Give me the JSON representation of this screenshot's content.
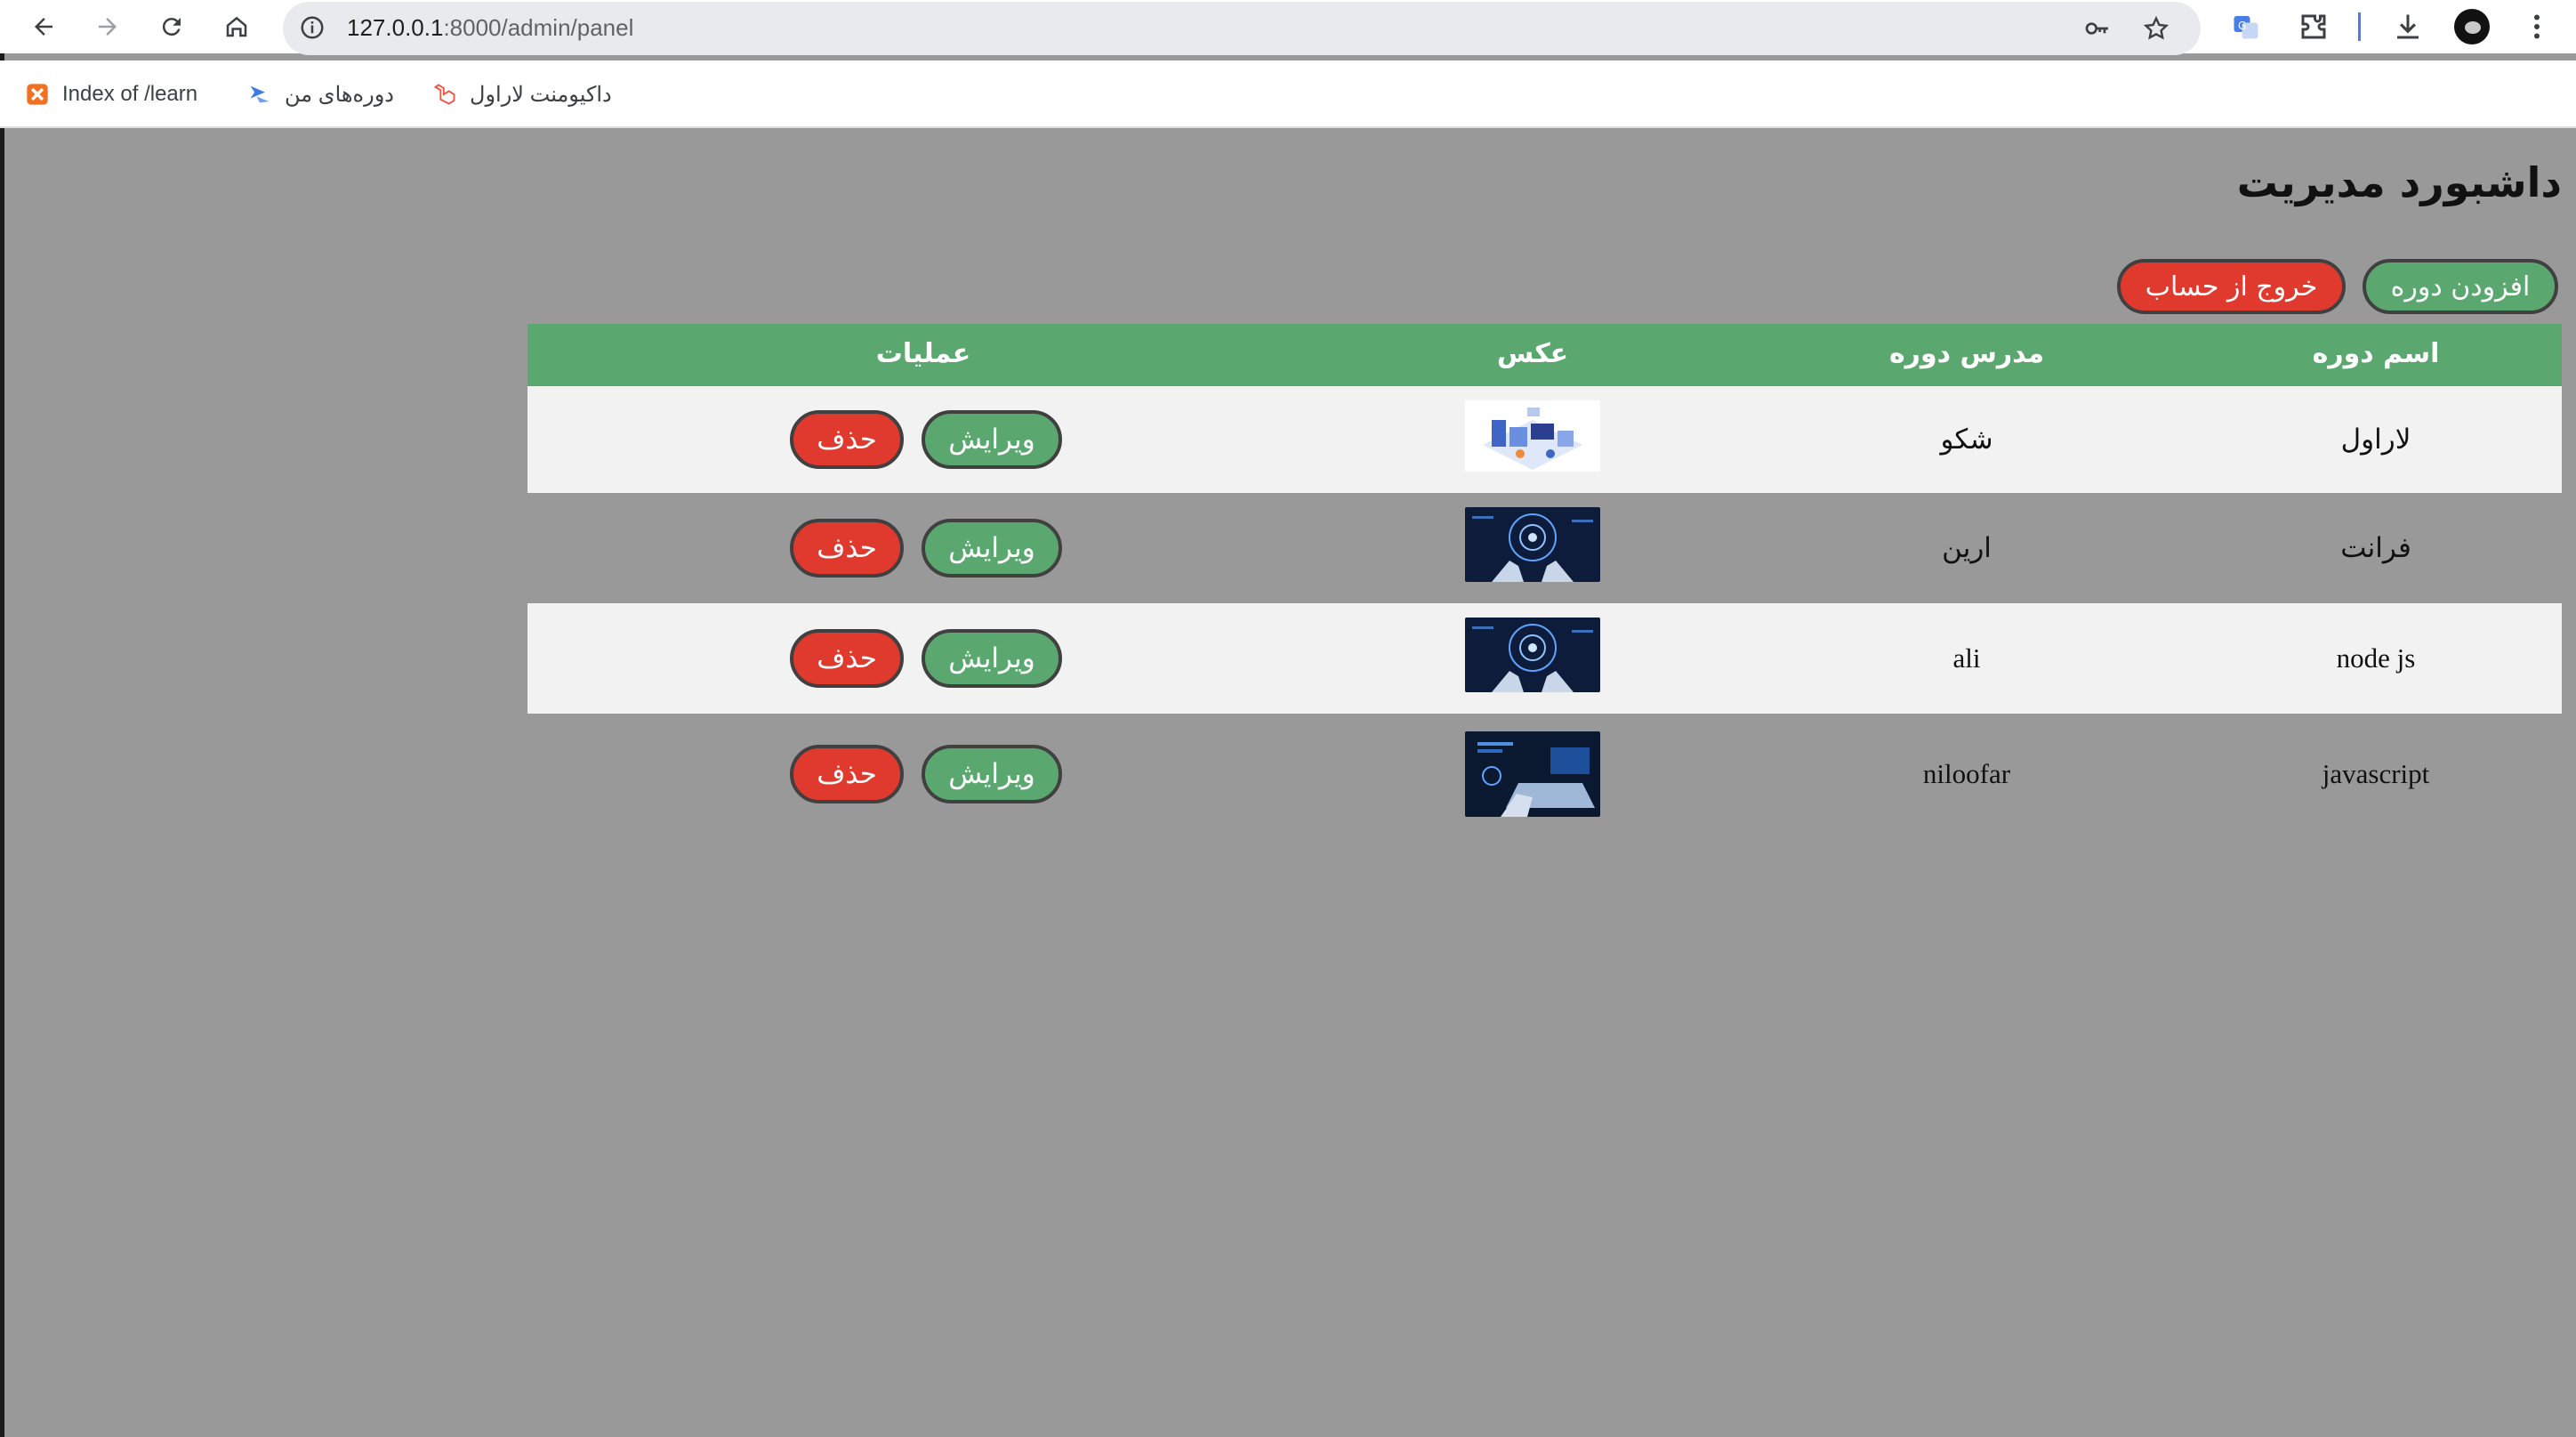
{
  "browser": {
    "url_host": "127.0.0.1",
    "url_rest": ":8000/admin/panel",
    "bookmarks": [
      {
        "label": "Index of /learn",
        "icon": "xampp-icon"
      },
      {
        "label": "دوره‌های من",
        "icon": "bookmark-arrow-icon"
      },
      {
        "label": "داکیومنت لاراول",
        "icon": "laravel-icon"
      }
    ]
  },
  "page": {
    "title": "داشبورد مدیریت",
    "add_course_label": "افزودن دوره",
    "logout_label": "خروج از حساب"
  },
  "table": {
    "headers": {
      "name": "اسم دوره",
      "teacher": "مدرس دوره",
      "photo": "عکس",
      "actions": "عملیات"
    },
    "edit_label": "ویرایش",
    "delete_label": "حذف",
    "rows": [
      {
        "name": "لاراول",
        "teacher": "شکو",
        "image": "isometric-illustration"
      },
      {
        "name": "فرانت",
        "teacher": "ارین",
        "image": "ai-hands-dark"
      },
      {
        "name": "node js",
        "teacher": "ali",
        "image": "ai-hands-dark"
      },
      {
        "name": "javascript",
        "teacher": "niloofar",
        "image": "laptop-tech-dark"
      }
    ]
  },
  "colors": {
    "page_bg": "#999999",
    "header_green": "#5aa86f",
    "danger_red": "#e0392e",
    "light_row": "#f2f2f2"
  }
}
